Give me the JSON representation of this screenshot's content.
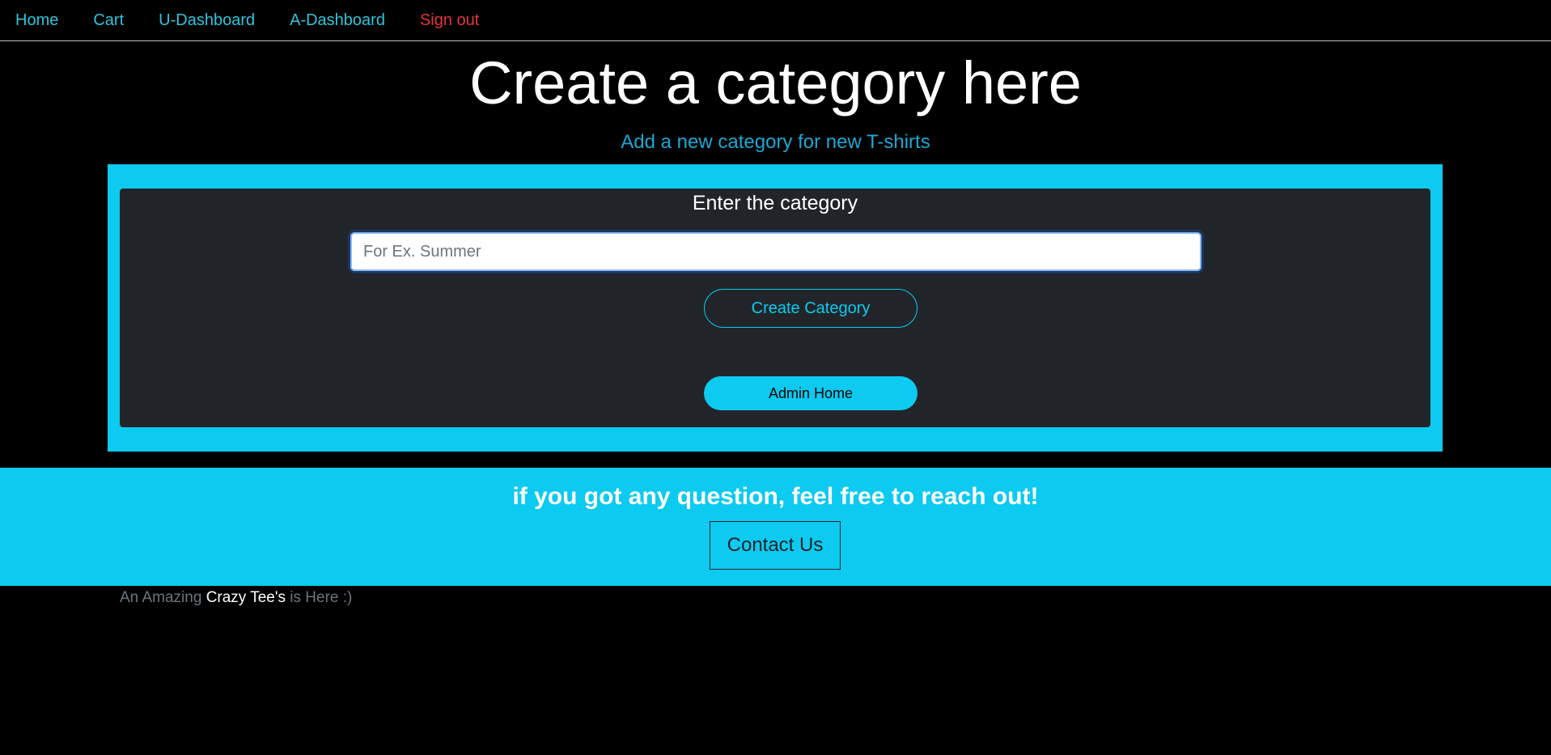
{
  "nav": {
    "home": "Home",
    "cart": "Cart",
    "user_dashboard": "U-Dashboard",
    "admin_dashboard": "A-Dashboard",
    "sign_out": "Sign out"
  },
  "header": {
    "title": "Create a category here",
    "subtitle": "Add a new category for new T-shirts"
  },
  "form": {
    "label": "Enter the category",
    "input_value": "",
    "input_placeholder": "For Ex. Summer",
    "create_button": "Create Category",
    "admin_home_button": "Admin Home"
  },
  "footer": {
    "heading": "if you got any question, feel free to reach out!",
    "contact_button": "Contact Us",
    "tagline_prefix": "An Amazing",
    "tagline_brand": "Crazy Tee's",
    "tagline_suffix": "is Here :)"
  },
  "colors": {
    "accent": "#0dcaf0",
    "nav_link": "#2ec4db",
    "sign_out": "#e5343e",
    "card_bg": "#212529",
    "page_bg": "#000000"
  }
}
